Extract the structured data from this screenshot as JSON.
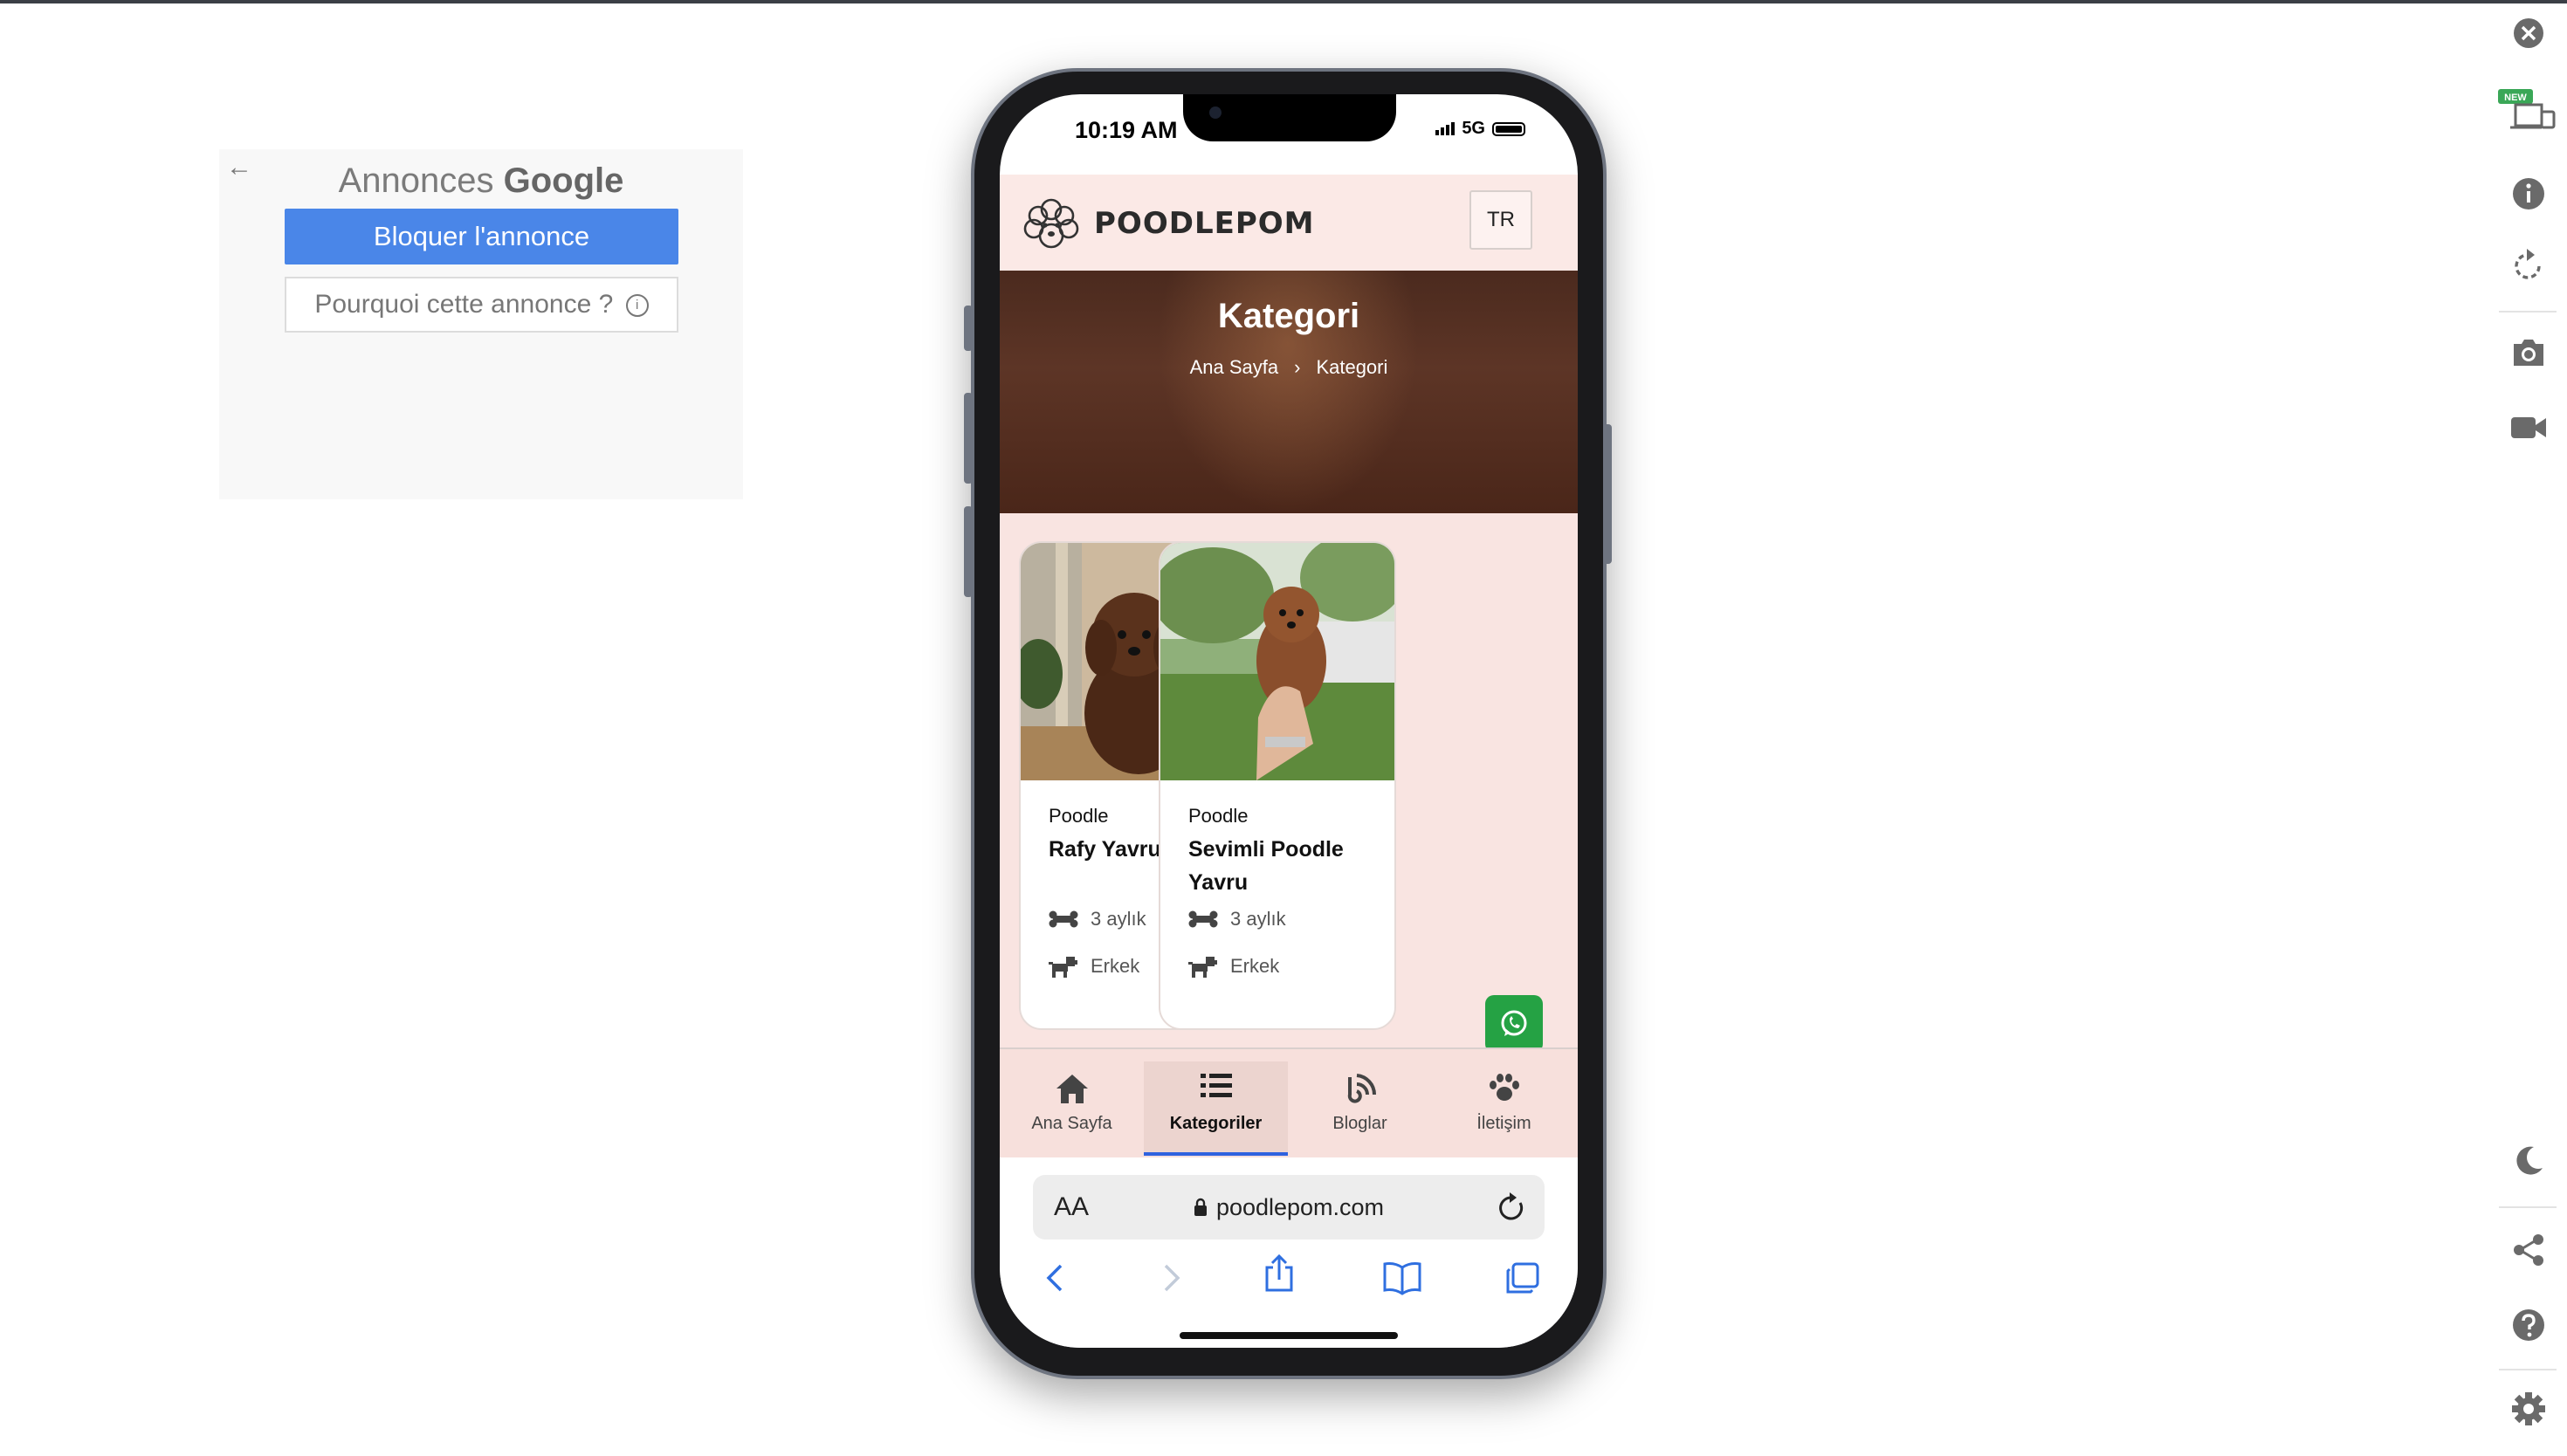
{
  "ad": {
    "title_prefix": "Annonces",
    "title_brand": "Google",
    "block_button": "Bloquer l'annonce",
    "why_button": "Pourquoi cette annonce ?",
    "info_glyph": "i"
  },
  "status_bar": {
    "time": "10:19 AM",
    "network": "5G"
  },
  "site": {
    "brand": "POODLEPOM",
    "language_button": "TR",
    "hero": {
      "title": "Kategori",
      "breadcrumb": [
        "Ana Sayfa",
        "Kategori"
      ]
    },
    "cards": [
      {
        "category": "Poodle",
        "title": "Rafy Yavru Poodle",
        "age": "3 aylık",
        "gender": "Erkek",
        "photo": "brown-poodle-puppy-sitting"
      },
      {
        "category": "Poodle",
        "title": "Sevimli Poodle Yavru",
        "age": "3 aylık",
        "gender": "Erkek",
        "photo": "poodle-puppy-held-in-hand"
      }
    ],
    "bottom_nav": [
      {
        "label": "Ana Sayfa",
        "icon": "home-icon",
        "active": false
      },
      {
        "label": "Kategoriler",
        "icon": "list-icon",
        "active": true
      },
      {
        "label": "Bloglar",
        "icon": "blog-icon",
        "active": false
      },
      {
        "label": "İletişim",
        "icon": "paw-icon",
        "active": false
      }
    ],
    "colors": {
      "whatsapp": "#25a244",
      "call": "#2f62df",
      "active_tab": "#2f62df",
      "page_bg": "#f9e4e1"
    }
  },
  "safari": {
    "text_size": "AA",
    "url": "poodlepom.com"
  },
  "right_toolbar": {
    "new_badge": "NEW",
    "icons": [
      "close-icon",
      "device-icon",
      "info-icon",
      "rotate-icon",
      "camera-icon",
      "video-icon",
      "moon-icon",
      "share-icon",
      "help-icon",
      "settings-icon"
    ]
  }
}
